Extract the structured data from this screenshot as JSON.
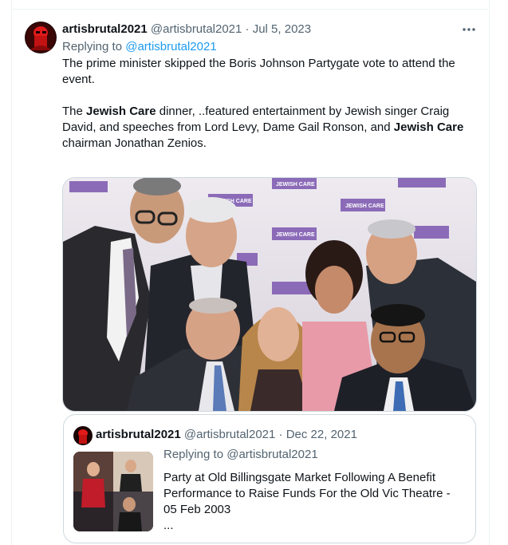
{
  "tweet": {
    "display_name": "artisbrutal2021",
    "handle": "@artisbrutal2021",
    "separator": "·",
    "date": "Jul 5, 2023",
    "more_icon": "more-horizontal-icon",
    "replying_prefix": "Replying to",
    "replying_handle": "@artisbrutal2021",
    "para1": "The prime minister skipped the Boris Johnson Partygate vote to attend the event.",
    "para2_a": "The ",
    "para2_b": "Jewish Care",
    "para2_c": " dinner, ..featured entertainment by Jewish singer Craig David, and speeches from  Lord Levy, Dame Gail Ronson, and ",
    "para2_d": "Jewish Care",
    "para2_e": " chairman Jonathan Zenios.",
    "photo_sign_text": "JEWISH CARE"
  },
  "quoted": {
    "display_name": "artisbrutal2021",
    "handle": "@artisbrutal2021",
    "separator": "·",
    "date": "Dec 22, 2021",
    "replying": "Replying to @artisbrutal2021",
    "text": "Party at Old Billingsgate Market Following A Benefit Performance to Raise Funds For the Old Vic Theatre - 05 Feb 2003",
    "ellipsis": "..."
  },
  "colors": {
    "text": "#0f1419",
    "muted": "#536471",
    "link": "#1d9bf0",
    "border": "#cfd9de",
    "sign_purple": "#8b6bb8"
  }
}
